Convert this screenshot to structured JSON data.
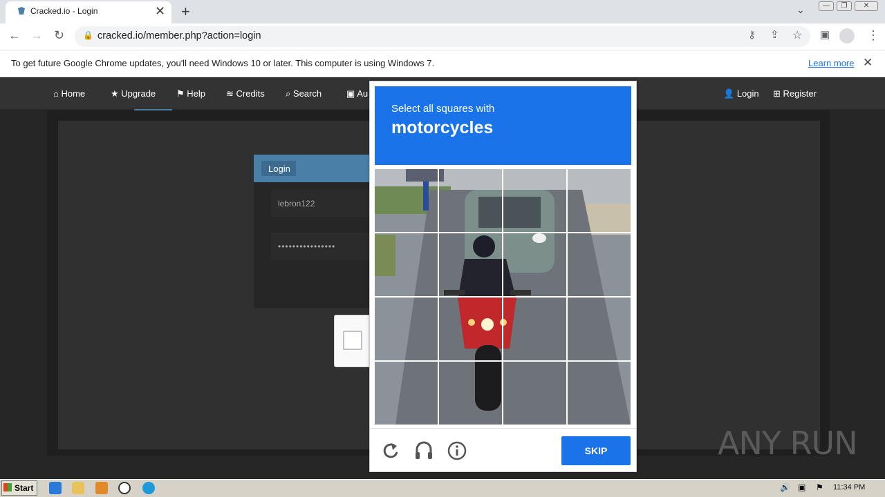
{
  "browser": {
    "tab_title": "Cracked.io - Login",
    "url": "cracked.io/member.php?action=login",
    "info_text": "To get future Google Chrome updates, you'll need Windows 10 or later. This computer is using Windows 7.",
    "learn_more": "Learn more"
  },
  "site": {
    "nav": [
      "Home",
      "Upgrade",
      "Help",
      "Credits",
      "Search",
      "Au"
    ],
    "nav_right": [
      "Login",
      "Register"
    ],
    "login_title": "Login",
    "username": "lebron122",
    "password": "••••••••••••••••"
  },
  "captcha": {
    "subtitle": "Select all squares with",
    "target": "motorcycles",
    "skip": "SKIP",
    "grid_size": 4
  },
  "watermark": "ANY RUN",
  "taskbar": {
    "start": "Start",
    "clock": "11:34 PM"
  }
}
